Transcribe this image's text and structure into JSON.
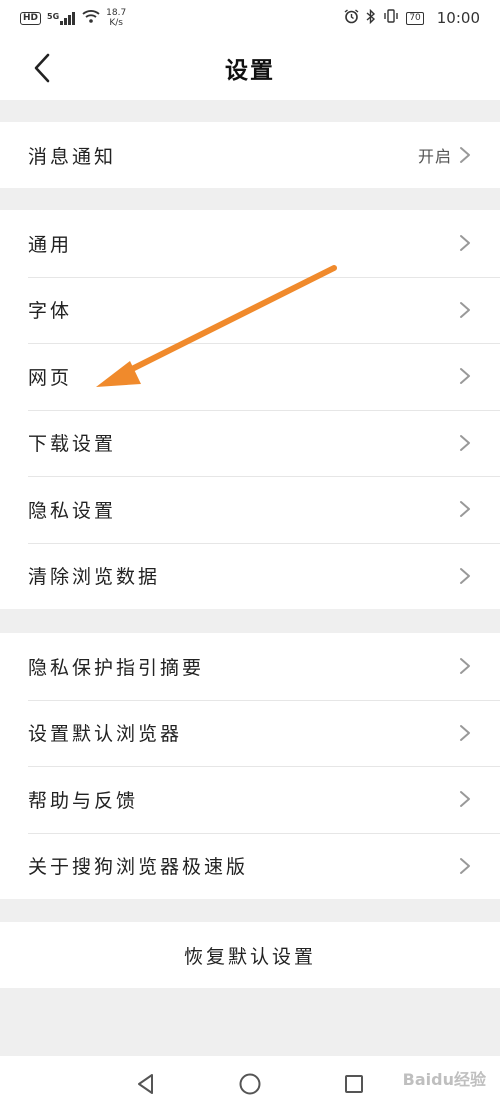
{
  "status_bar": {
    "hd": "HD",
    "network": "5G",
    "speed_value": "18.7",
    "speed_unit": "K/s",
    "battery": "70",
    "time": "10:00"
  },
  "header": {
    "title": "设置",
    "back_icon": "chevron-left-icon"
  },
  "notification": {
    "label": "消息通知",
    "value": "开启"
  },
  "general_group": [
    {
      "label": "通用"
    },
    {
      "label": "字体"
    },
    {
      "label": "网页"
    },
    {
      "label": "下载设置"
    },
    {
      "label": "隐私设置"
    },
    {
      "label": "清除浏览数据"
    }
  ],
  "about_group": [
    {
      "label": "隐私保护指引摘要"
    },
    {
      "label": "设置默认浏览器"
    },
    {
      "label": "帮助与反馈"
    },
    {
      "label": "关于搜狗浏览器极速版"
    }
  ],
  "reset": {
    "label": "恢复默认设置"
  },
  "system_nav": [
    "back-triangle-icon",
    "home-circle-icon",
    "recents-square-icon"
  ],
  "watermark": "Baidu经验",
  "colors": {
    "annotation_arrow": "#f08a2c",
    "background": "#efefef"
  }
}
